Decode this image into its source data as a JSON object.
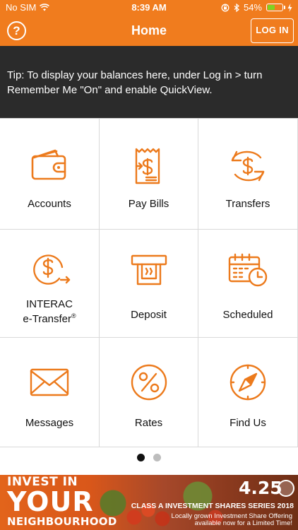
{
  "status_bar": {
    "carrier": "No SIM",
    "time": "8:39 AM",
    "battery_percent": "54%",
    "battery_level": 0.54,
    "icons": [
      "wifi-icon",
      "orientation-lock-icon",
      "bluetooth-icon",
      "battery-icon",
      "charging-icon"
    ]
  },
  "nav": {
    "help_label": "?",
    "title": "Home",
    "login_label": "LOG IN"
  },
  "tip": {
    "text": "Tip: To display your balances here, under Log in > turn Remember Me \"On\" and enable QuickView."
  },
  "menu": [
    {
      "label": "Accounts",
      "icon": "wallet-icon"
    },
    {
      "label": "Pay Bills",
      "icon": "bill-icon"
    },
    {
      "label": "Transfers",
      "icon": "transfer-icon"
    },
    {
      "label_line1": "INTERAC",
      "label_line2": "e-Transfer",
      "label_sup": "®",
      "icon": "etransfer-icon"
    },
    {
      "label": "Deposit",
      "icon": "deposit-icon"
    },
    {
      "label": "Scheduled",
      "icon": "calendar-clock-icon"
    },
    {
      "label": "Messages",
      "icon": "envelope-icon"
    },
    {
      "label": "Rates",
      "icon": "percent-icon"
    },
    {
      "label": "Find Us",
      "icon": "compass-icon"
    }
  ],
  "pager": {
    "pages": 2,
    "current": 1
  },
  "banner": {
    "line1": "INVEST IN",
    "line2": "YOUR",
    "line3": "NEIGHBOURHOOD",
    "rate": "4.25",
    "series": "CLASS A INVESTMENT SHARES SERIES 2018",
    "sub1": "Locally grown Investment Share Offering",
    "sub2": "available now for a Limited Time!"
  },
  "colors": {
    "brand_orange": "#f07c1e",
    "tip_background": "#2b2b2b",
    "icon_orange": "#ec7a1c",
    "dot_active": "#111111",
    "dot_inactive": "#bdbdbd",
    "grid_line": "#d9d9d9"
  }
}
